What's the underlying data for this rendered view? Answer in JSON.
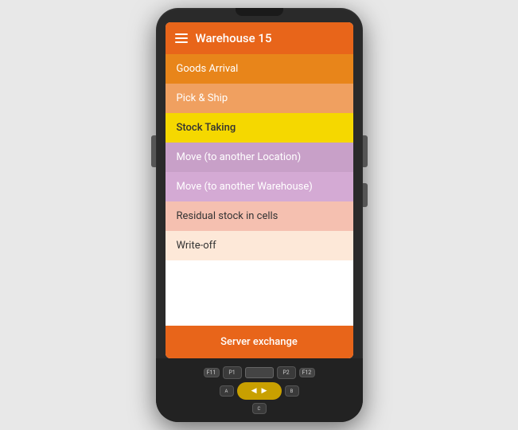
{
  "header": {
    "title": "Warehouse 15",
    "menu_icon": "hamburger"
  },
  "menu": {
    "items": [
      {
        "id": "goods-arrival",
        "label": "Goods Arrival",
        "class": "mi-goods-arrival"
      },
      {
        "id": "pick-ship",
        "label": "Pick & Ship",
        "class": "mi-pick-ship"
      },
      {
        "id": "stock-taking",
        "label": "Stock Taking",
        "class": "mi-stock-taking"
      },
      {
        "id": "move-location",
        "label": "Move (to another Location)",
        "class": "mi-move-location"
      },
      {
        "id": "move-warehouse",
        "label": "Move (to another Warehouse)",
        "class": "mi-move-warehouse"
      },
      {
        "id": "residual",
        "label": "Residual stock in cells",
        "class": "mi-residual"
      },
      {
        "id": "writeoff",
        "label": "Write-off",
        "class": "mi-writeoff"
      }
    ],
    "server_button_label": "Server exchange"
  },
  "keypad": {
    "f11": "F11",
    "f12": "F12",
    "p1": "P1",
    "p2": "P2",
    "a": "A",
    "b": "B",
    "c": "C"
  },
  "colors": {
    "header_bg": "#e8651a",
    "server_btn": "#e8651a"
  }
}
